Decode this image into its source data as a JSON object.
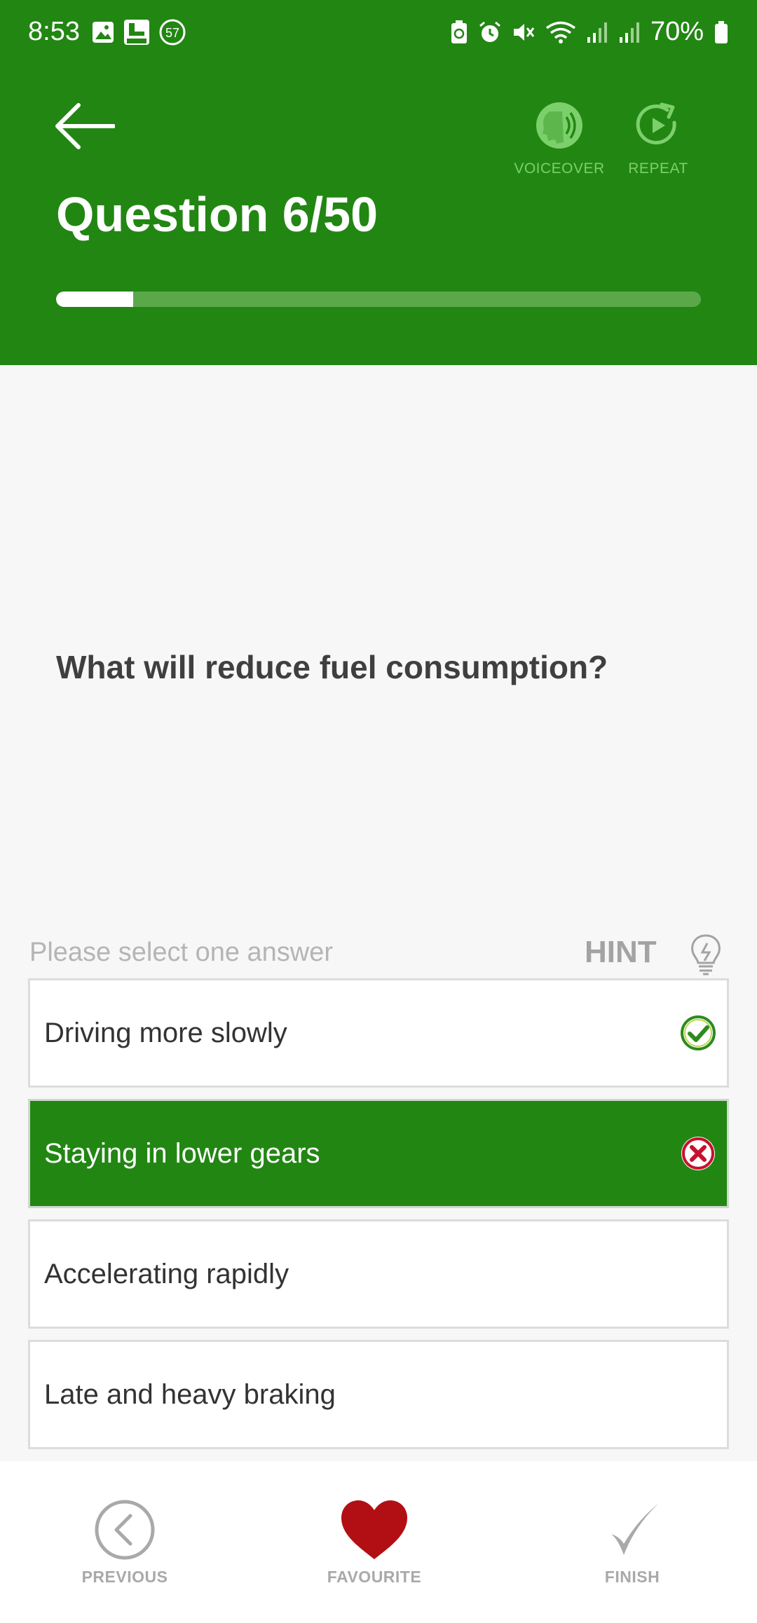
{
  "status_bar": {
    "time": "8:53",
    "notification_count": "57",
    "battery": "70%"
  },
  "header": {
    "title": "Question 6/50",
    "voiceover_label": "VOICEOVER",
    "repeat_label": "REPEAT",
    "progress": {
      "current": 6,
      "total": 50
    }
  },
  "question": {
    "text": "What will reduce fuel consumption?"
  },
  "answers_section": {
    "instruction": "Please select one answer",
    "hint_label": "HINT",
    "answers": [
      {
        "label": "Driving more slowly",
        "state": "correct"
      },
      {
        "label": "Staying in lower gears",
        "state": "selected-wrong"
      },
      {
        "label": "Accelerating rapidly",
        "state": "none"
      },
      {
        "label": "Late and heavy braking",
        "state": "none"
      }
    ]
  },
  "bottom_nav": {
    "previous_label": "PREVIOUS",
    "favourite_label": "FAVOURITE",
    "finish_label": "FINISH"
  },
  "colors": {
    "brand_green": "#228613",
    "heart_red": "#b20f14",
    "correct_green": "#2e8a1f",
    "wrong_red": "#c8102e"
  },
  "icons": [
    "gallery-icon",
    "app-4in1-icon",
    "notification-count-icon",
    "battery-saver-icon",
    "alarm-icon",
    "mute-icon",
    "wifi-icon",
    "signal-icon",
    "battery-icon",
    "back-arrow-icon",
    "voiceover-icon",
    "repeat-icon",
    "lightbulb-icon",
    "check-circle-icon",
    "x-circle-icon",
    "chevron-left-circle-icon",
    "heart-icon",
    "checkmark-icon"
  ]
}
